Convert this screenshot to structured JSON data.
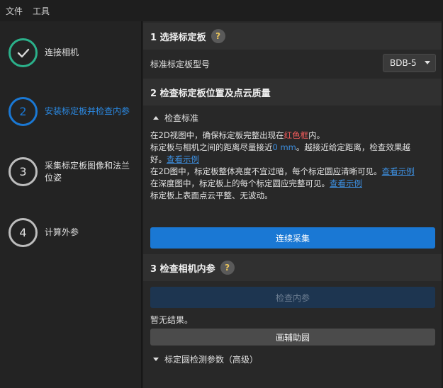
{
  "menu": {
    "file": "文件",
    "tools": "工具"
  },
  "steps": [
    {
      "num": "",
      "label": "连接相机"
    },
    {
      "num": "2",
      "label": "安装标定板并检查内参"
    },
    {
      "num": "3",
      "label": "采集标定板图像和法兰位姿"
    },
    {
      "num": "4",
      "label": "计算外参"
    }
  ],
  "section1": {
    "title": "1 选择标定板",
    "help": "?",
    "board_model_label": "标准标定板型号",
    "board_model_value": "BDB-5"
  },
  "section2": {
    "title": "2 检查标定板位置及点云质量",
    "criteria_toggle": "检查标准",
    "line1_a": "在2D视图中，确保标定板完整出现在",
    "line1_red": "红色框",
    "line1_b": "内。",
    "line2_a": "标定板与相机之间的距离尽量接近",
    "line2_blue": "0 mm",
    "line2_b": "。越接近给定距离，检查效果越",
    "line3_a": "好。",
    "line3_link": "查看示例",
    "line4_a": "在2D图中，标定板整体亮度不宜过暗，每个标定圆应清晰可见。",
    "line4_link": "查看示例",
    "line5_a": "在深度图中，标定板上的每个标定圆应完整可见。",
    "line5_link": "查看示例",
    "line6": "标定板上表面点云平整、无波动。",
    "continuous_capture": "连续采集"
  },
  "section3": {
    "title": "3 检查相机内参",
    "help": "?",
    "check_button": "检查内参",
    "no_result": "暂无结果。",
    "draw_circle_button": "画辅助圆",
    "advanced_toggle": "标定圆检测参数（高级）"
  },
  "colors": {
    "accent": "#1a78d4",
    "done": "#2bb08a",
    "red_text": "#f05a5a",
    "link": "#3d8fe0"
  }
}
